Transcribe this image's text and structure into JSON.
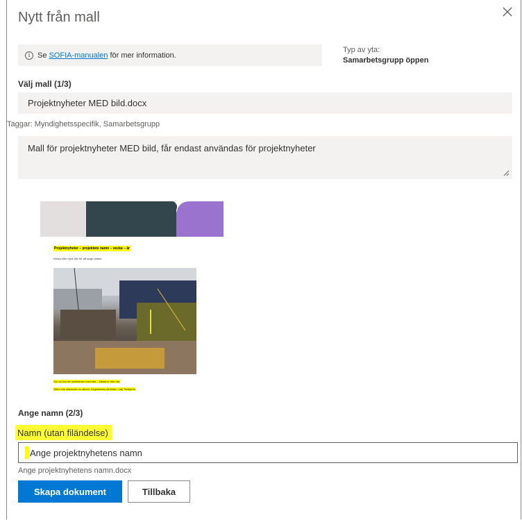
{
  "dialog": {
    "title": "Nytt från mall"
  },
  "info": {
    "prefix": "Se",
    "link": "SOFIA-manualen",
    "suffix": "för mer information."
  },
  "area_type": {
    "label": "Typ av yta:",
    "value": "Samarbetsgrupp öppen"
  },
  "template_step": {
    "label": "Välj mall (1/3)",
    "selected": "Projektnyheter MED bild.docx",
    "tags": "Taggar: Myndighetsspecifik, Samarbetsgrupp",
    "description": "Mall för projektnyheter MED bild, får endast användas för projektnyheter"
  },
  "preview": {
    "heading": "Projektnyheter – projektets namn – vecka – år",
    "date_hint": "Klicka eller tryck här för att ange datum.",
    "caption1": "Om du har ett nyhetsbrev med bild – klistra in den här.",
    "caption2": "Glöm inte alternativ en alttext, högerklicka på bilden, välj Textbjerre",
    "band_colors": [
      "#e3dfdf",
      "#33454d",
      "#9a73cf"
    ]
  },
  "name_step": {
    "label": "Ange namn (2/3)",
    "field_label": "Namn (utan filändelse)",
    "placeholder": "Ange projektnyhetens namn",
    "filename": "Ange projektnyhetens namn.docx"
  },
  "buttons": {
    "create": "Skapa dokument",
    "back": "Tillbaka"
  },
  "colors": {
    "accent": "#0078d4",
    "highlight": "#ffff00"
  }
}
